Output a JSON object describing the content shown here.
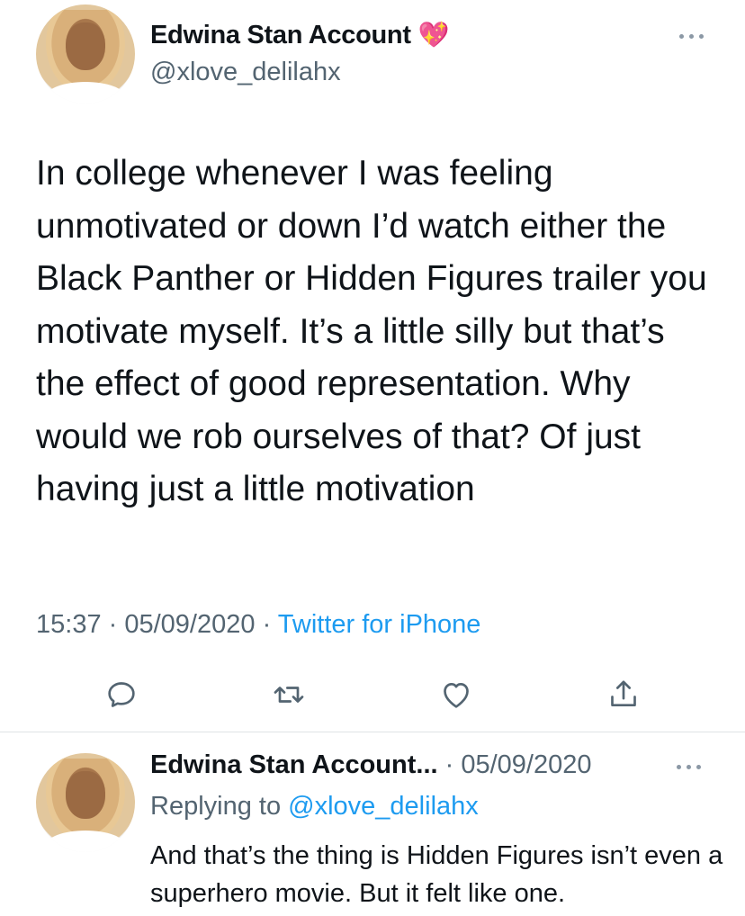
{
  "tweet": {
    "author_name": "Edwina Stan Account",
    "author_emoji": "💖",
    "author_handle": "@xlove_delilahx",
    "body": "In college whenever I was feeling unmotivated or down I’d watch either the Black Panther or Hidden Figures trailer you motivate myself. It’s a little silly but that’s the effect of good representation. Why would we rob ourselves of that? Of just having just a little motivation",
    "time": "15:37",
    "separator": " · ",
    "date": "05/09/2020",
    "source": "Twitter for iPhone",
    "actions": [
      "reply-icon",
      "retweet-icon",
      "like-icon",
      "share-icon"
    ]
  },
  "reply": {
    "author_name": "Edwina Stan Account...",
    "separator": " · ",
    "date": "05/09/2020",
    "replying_to_label": "Replying to ",
    "replying_to_handle": "@xlove_delilahx",
    "body": "And that’s the thing is Hidden Figures isn’t even a superhero movie. But it felt like one."
  },
  "colors": {
    "text": "#0f1419",
    "secondary": "#536471",
    "link": "#1d9bf0"
  }
}
